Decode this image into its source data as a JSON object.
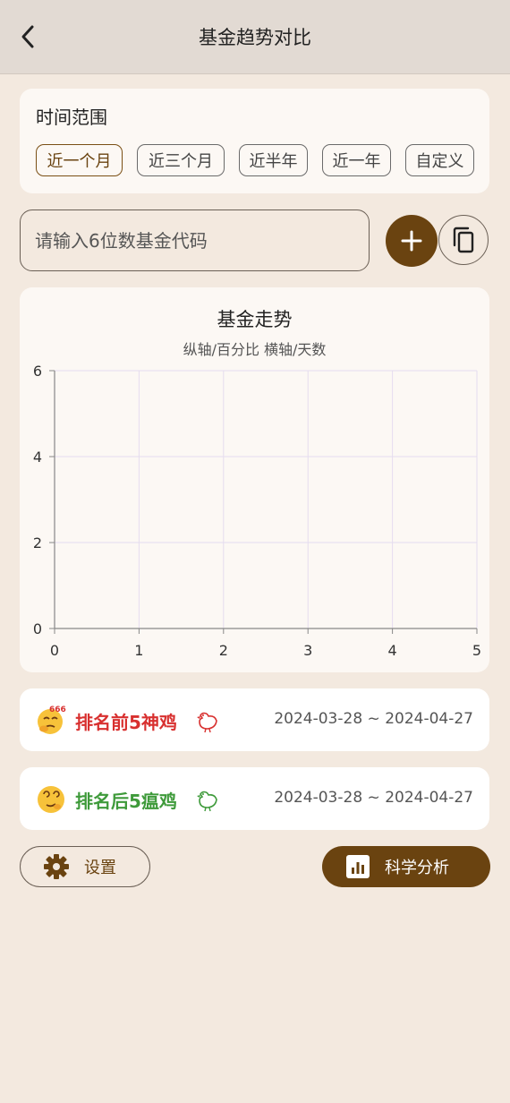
{
  "header": {
    "title": "基金趋势对比",
    "back_icon": "back-arrow-icon"
  },
  "time_range": {
    "title": "时间范围",
    "options": [
      "近一个月",
      "近三个月",
      "近半年",
      "近一年",
      "自定义"
    ],
    "selected": "近一个月"
  },
  "fund_input": {
    "value": "",
    "placeholder": "请输入6位数基金代码"
  },
  "actions": {
    "add_icon": "plus-icon",
    "copy_icon": "copy-icon"
  },
  "chart": {
    "title": "基金走势",
    "subtitle": "纵轴/百分比 横轴/天数"
  },
  "chart_data": {
    "type": "line",
    "title": "基金走势",
    "subtitle": "纵轴/百分比 横轴/天数",
    "series": [],
    "xlim": [
      0,
      5
    ],
    "ylim": [
      0,
      6
    ],
    "x_ticks": [
      "0",
      "1",
      "2",
      "3",
      "4",
      "5"
    ],
    "y_ticks": [
      "0",
      "2",
      "4",
      "6"
    ],
    "grid": true
  },
  "rankings": [
    {
      "label": "排名前5神鸡",
      "date_range": "2024-03-28 ~ 2024-04-27",
      "color": "#d8302f",
      "emoji": "thinking-666-emoji",
      "chick": "chick-icon"
    },
    {
      "label": "排名后5瘟鸡",
      "date_range": "2024-03-28 ~ 2024-04-27",
      "color": "#3e9a3a",
      "emoji": "dizzy-face-emoji",
      "chick": "chick-icon"
    }
  ],
  "bottom": {
    "settings_label": "设置",
    "settings_icon": "gear-icon",
    "analysis_label": "科学分析",
    "analysis_icon": "bar-chart-icon"
  },
  "colors": {
    "accent": "#6a4310",
    "background": "#f3e9df",
    "header": "#e2dad3",
    "grid": "#e5dcef"
  }
}
